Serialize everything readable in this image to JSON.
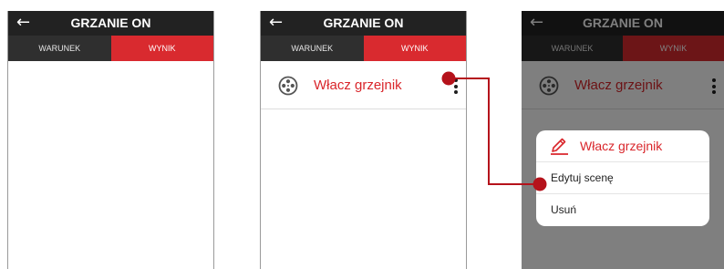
{
  "screens": [
    {
      "header": {
        "back_icon": "arrow-left-icon",
        "title": "GRZANIE ON"
      },
      "tabs": [
        {
          "label": "WARUNEK",
          "active": false
        },
        {
          "label": "WYNIK",
          "active": true
        }
      ]
    },
    {
      "header": {
        "back_icon": "arrow-left-icon",
        "title": "GRZANIE ON"
      },
      "tabs": [
        {
          "label": "WARUNEK",
          "active": false
        },
        {
          "label": "WYNIK",
          "active": true
        }
      ],
      "scene": {
        "icon": "film-reel-icon",
        "label": "Włacz grzejnik",
        "more_icon": "more-vertical-icon"
      }
    },
    {
      "header": {
        "back_icon": "arrow-left-icon",
        "title": "GRZANIE ON"
      },
      "tabs": [
        {
          "label": "WARUNEK",
          "active": false
        },
        {
          "label": "WYNIK",
          "active": true
        }
      ],
      "scene": {
        "icon": "film-reel-icon",
        "label": "Włacz grzejnik",
        "more_icon": "more-vertical-icon"
      },
      "menu": {
        "title_icon": "pencil-icon",
        "title": "Włacz grzejnik",
        "items": [
          {
            "label": "Edytuj scenę"
          },
          {
            "label": "Usuń"
          }
        ]
      }
    }
  ],
  "colors": {
    "accent": "#d9262b",
    "header": "#222222",
    "tab_inactive": "#2f2f2f",
    "tab_active": "#d92a2f",
    "callout": "#b5121b"
  }
}
